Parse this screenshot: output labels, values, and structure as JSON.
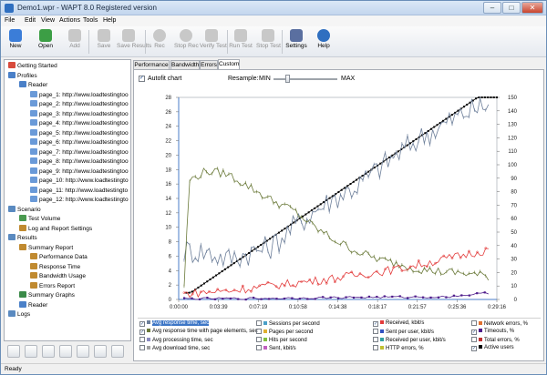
{
  "window": {
    "title": "Demo1.wpr - WAPT 8.0 Registered version",
    "min": "–",
    "max": "□",
    "close": "✕"
  },
  "menu": [
    "File",
    "Edit",
    "View",
    "Actions",
    "Tools",
    "Help"
  ],
  "toolbar": [
    {
      "label": "New",
      "icon": "new-document-icon",
      "enabled": true,
      "color": "#3b7dd8"
    },
    {
      "label": "Open",
      "icon": "open-folder-icon",
      "enabled": true,
      "color": "#3c9e45"
    },
    {
      "label": "Add",
      "icon": "add-icon",
      "enabled": false,
      "color": "#c8c8c8"
    },
    {
      "label": "Save",
      "icon": "save-icon",
      "enabled": false,
      "color": "#c8c8c8"
    },
    {
      "label": "Save Results",
      "icon": "save-results-icon",
      "enabled": false,
      "color": "#c8c8c8"
    },
    {
      "label": "Rec",
      "icon": "record-icon",
      "enabled": false,
      "color": "#c8c8c8"
    },
    {
      "label": "Stop Rec",
      "icon": "stop-record-icon",
      "enabled": false,
      "color": "#c8c8c8"
    },
    {
      "label": "Verify Test",
      "icon": "verify-test-icon",
      "enabled": false,
      "color": "#c8c8c8"
    },
    {
      "label": "Run Test",
      "icon": "run-test-icon",
      "enabled": false,
      "color": "#c8c8c8"
    },
    {
      "label": "Stop Test",
      "icon": "stop-test-icon",
      "enabled": false,
      "color": "#c8c8c8"
    },
    {
      "label": "Settings",
      "icon": "settings-gear-icon",
      "enabled": true,
      "color": "#5a6fa0"
    },
    {
      "label": "Help",
      "icon": "help-icon",
      "enabled": true,
      "color": "#2f6fc0"
    }
  ],
  "tree": [
    {
      "label": "Getting Started",
      "level": 0,
      "icon": "getting-started-icon",
      "color": "#d84b3c"
    },
    {
      "label": "Profiles",
      "level": 0,
      "icon": "profiles-icon",
      "color": "#4a80c8"
    },
    {
      "label": "Reader",
      "level": 1,
      "icon": "reader-profile-icon",
      "color": "#4a80c8"
    },
    {
      "label": "page_1: http://www.loadtestingtoo",
      "level": 2,
      "icon": "page-icon",
      "color": "#6a9ad8"
    },
    {
      "label": "page_2: http://www.loadtestingtoo",
      "level": 2,
      "icon": "page-icon",
      "color": "#6a9ad8"
    },
    {
      "label": "page_3: http://www.loadtestingtoo",
      "level": 2,
      "icon": "page-icon",
      "color": "#6a9ad8"
    },
    {
      "label": "page_4: http://www.loadtestingtoo",
      "level": 2,
      "icon": "page-icon",
      "color": "#6a9ad8"
    },
    {
      "label": "page_5: http://www.loadtestingtoo",
      "level": 2,
      "icon": "page-icon",
      "color": "#6a9ad8"
    },
    {
      "label": "page_6: http://www.loadtestingtoo",
      "level": 2,
      "icon": "page-icon",
      "color": "#6a9ad8"
    },
    {
      "label": "page_7: http://www.loadtestingtoo",
      "level": 2,
      "icon": "page-icon",
      "color": "#6a9ad8"
    },
    {
      "label": "page_8: http://www.loadtestingtoo",
      "level": 2,
      "icon": "page-icon",
      "color": "#6a9ad8"
    },
    {
      "label": "page_9: http://www.loadtestingtoo",
      "level": 2,
      "icon": "page-icon",
      "color": "#6a9ad8"
    },
    {
      "label": "page_10: http://www.loadtestingto",
      "level": 2,
      "icon": "page-icon",
      "color": "#6a9ad8"
    },
    {
      "label": "page_11: http://www.loadtestingto",
      "level": 2,
      "icon": "page-icon",
      "color": "#6a9ad8"
    },
    {
      "label": "page_12: http://www.loadtestingto",
      "level": 2,
      "icon": "page-icon",
      "color": "#6a9ad8"
    },
    {
      "label": "Scenario",
      "level": 0,
      "icon": "scenario-icon",
      "color": "#5a8ac0"
    },
    {
      "label": "Test Volume",
      "level": 1,
      "icon": "test-volume-icon",
      "color": "#4a9a50"
    },
    {
      "label": "Log and Report Settings",
      "level": 1,
      "icon": "log-settings-icon",
      "color": "#c08a30"
    },
    {
      "label": "Results",
      "level": 0,
      "icon": "results-icon",
      "color": "#5a8ac0"
    },
    {
      "label": "Summary Report",
      "level": 1,
      "icon": "summary-report-icon",
      "color": "#c08a30"
    },
    {
      "label": "Performance Data",
      "level": 2,
      "icon": "performance-data-icon",
      "color": "#c08a30"
    },
    {
      "label": "Response Time",
      "level": 2,
      "icon": "response-time-icon",
      "color": "#c08a30"
    },
    {
      "label": "Bandwidth Usage",
      "level": 2,
      "icon": "bandwidth-usage-icon",
      "color": "#c08a30"
    },
    {
      "label": "Errors Report",
      "level": 2,
      "icon": "errors-report-icon",
      "color": "#c08a30"
    },
    {
      "label": "Summary Graphs",
      "level": 1,
      "icon": "summary-graphs-icon",
      "color": "#3a8a48"
    },
    {
      "label": "Reader",
      "level": 1,
      "icon": "reader-results-icon",
      "color": "#4a80c8"
    },
    {
      "label": "Logs",
      "level": 0,
      "icon": "logs-icon",
      "color": "#5a8ac0"
    }
  ],
  "tabs": [
    "Performance",
    "Bandwidth",
    "Errors",
    "Custom"
  ],
  "active_tab": "Custom",
  "options": {
    "autofit_label": "Autofit chart",
    "autofit_checked": true,
    "resample_label": "Resample:",
    "min_label": "MIN",
    "max_label": "MAX",
    "resample_level": 0.22
  },
  "chart_data": {
    "type": "line",
    "x_ticks": [
      "0:00:00",
      "0:03:39",
      "0:07:19",
      "0:10:58",
      "0:14:38",
      "0:18:17",
      "0:21:57",
      "0:25:36",
      "0:29:16"
    ],
    "y_left": {
      "min": 0,
      "max": 28,
      "ticks": [
        0,
        2,
        4,
        6,
        8,
        10,
        12,
        14,
        16,
        18,
        20,
        22,
        24,
        26,
        28
      ]
    },
    "y_right": {
      "min": 0,
      "max": 150,
      "ticks": [
        0,
        10,
        20,
        30,
        40,
        50,
        60,
        70,
        80,
        90,
        100,
        110,
        120,
        130,
        140,
        150
      ]
    },
    "x_range_minutes": [
      0,
      29.27
    ],
    "series": [
      {
        "name": "Active users",
        "axis": "right",
        "color": "#000000",
        "x": [
          0.7,
          1.1,
          27.5,
          30.9
        ],
        "values": [
          5,
          5,
          150,
          150
        ]
      },
      {
        "name": "Avg response time, sec",
        "axis": "left",
        "color": "#6d7f9a",
        "x": [
          0.5,
          2.5,
          4.5,
          6.5,
          8.5,
          10.5,
          12.5,
          14.5,
          16.5,
          18.5,
          20.5,
          22.5,
          24.5,
          26.5,
          28.5
        ],
        "values": [
          6.8,
          6.6,
          5.6,
          6.5,
          7.3,
          10.0,
          12.3,
          14.2,
          15.8,
          18.3,
          20.5,
          22.7,
          24.3,
          26.0,
          27.0
        ]
      },
      {
        "name": "Avg response time with page elements, sec",
        "axis": "left",
        "color": "#6b7a3a",
        "x": [
          0.5,
          1.0,
          2.5,
          4.5,
          6.5,
          8.5,
          10.5,
          12.5,
          14.5,
          16.5,
          18.5,
          20.5,
          22.5,
          24.5,
          26.5,
          28.5
        ],
        "values": [
          2,
          16.5,
          17.8,
          17.4,
          15.6,
          13.8,
          12.4,
          10.0,
          8.1,
          6.6,
          5.5,
          4.8,
          4.1,
          3.8,
          3.6,
          3.2
        ]
      },
      {
        "name": "Received, kbit/s",
        "axis": "left",
        "color": "#e33b3b",
        "x": [
          0.5,
          4.5,
          8.5,
          12.5,
          16.5,
          20.5,
          24.5,
          28.5
        ],
        "values": [
          0.8,
          1.2,
          1.9,
          2.6,
          3.4,
          4.3,
          5.6,
          6.9
        ]
      },
      {
        "name": "Timeouts, %",
        "axis": "left",
        "color": "#4d1a8a",
        "x": [
          0.5,
          8.5,
          16.5,
          24.5,
          28.5
        ],
        "values": [
          0.1,
          0.15,
          0.3,
          0.35,
          0.9
        ]
      }
    ]
  },
  "legend": [
    {
      "label": "Avg response time, sec",
      "checked": true,
      "color": "#6d7f9a",
      "selected": true
    },
    {
      "label": "Avg response time with page elements, sec",
      "checked": true,
      "color": "#6b7a3a",
      "selected": false
    },
    {
      "label": "Avg processing time, sec",
      "checked": false,
      "color": "#8a8ac0",
      "selected": false
    },
    {
      "label": "Avg download time, sec",
      "checked": false,
      "color": "#a0a0a0",
      "selected": false
    },
    {
      "label": "Sessions per second",
      "checked": false,
      "color": "#4aa0c8",
      "selected": false
    },
    {
      "label": "Pages per second",
      "checked": false,
      "color": "#e0b030",
      "selected": false
    },
    {
      "label": "Hits per second",
      "checked": false,
      "color": "#80c040",
      "selected": false
    },
    {
      "label": "Sent, kbit/s",
      "checked": false,
      "color": "#c060c0",
      "selected": false
    },
    {
      "label": "Received, kbit/s",
      "checked": true,
      "color": "#e33b3b",
      "selected": false
    },
    {
      "label": "Sent per user, kbit/s",
      "checked": false,
      "color": "#3050c0",
      "selected": false
    },
    {
      "label": "Received per user, kbit/s",
      "checked": false,
      "color": "#30a0a0",
      "selected": false
    },
    {
      "label": "HTTP errors, %",
      "checked": false,
      "color": "#c0c030",
      "selected": false
    },
    {
      "label": "Network errors, %",
      "checked": false,
      "color": "#e07030",
      "selected": false
    },
    {
      "label": "Timeouts, %",
      "checked": true,
      "color": "#4d1a8a",
      "selected": false
    },
    {
      "label": "Total errors, %",
      "checked": false,
      "color": "#c03030",
      "selected": false
    },
    {
      "label": "Active users",
      "checked": true,
      "color": "#000000",
      "selected": false
    }
  ],
  "status": "Ready"
}
